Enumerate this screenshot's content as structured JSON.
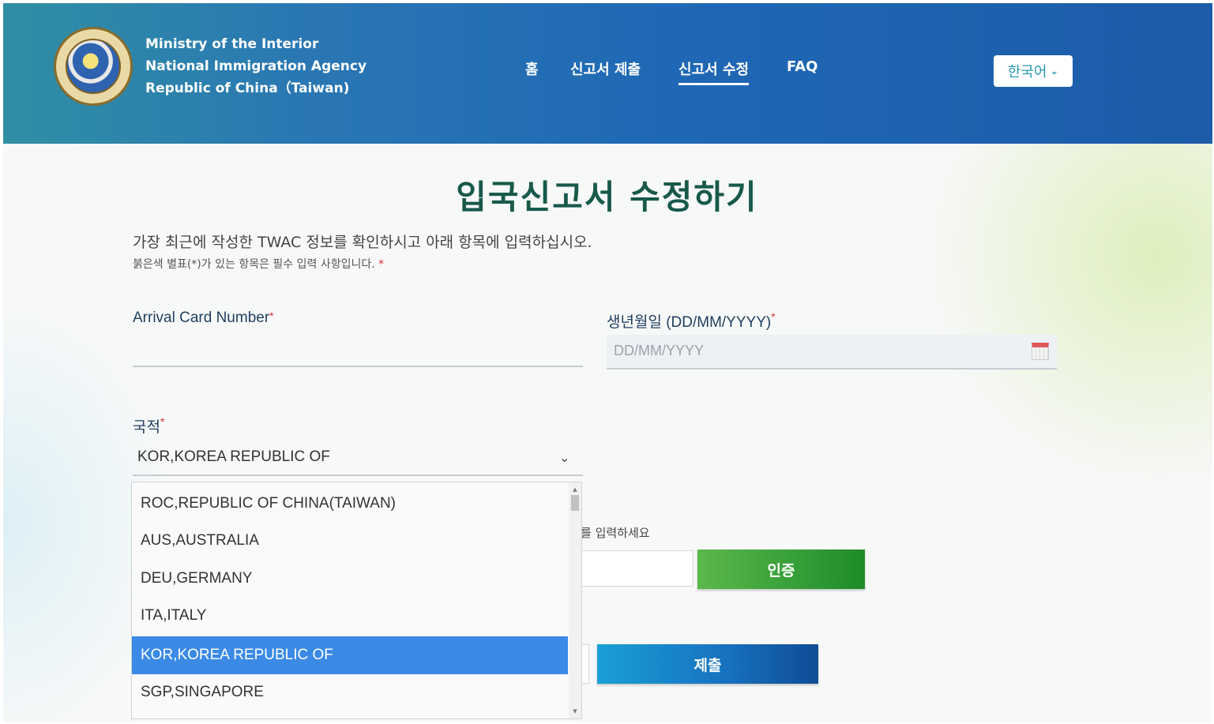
{
  "header": {
    "agency_lines": [
      "Ministry of the Interior",
      "National Immigration Agency",
      "Republic of China（Taiwan)"
    ],
    "nav": [
      {
        "label": "홈"
      },
      {
        "label": "신고서 제출"
      },
      {
        "label": "신고서 수정",
        "active": true
      },
      {
        "label": "FAQ"
      }
    ],
    "language": "한국어"
  },
  "page": {
    "title": "입국신고서 수정하기",
    "intro": "가장 최근에 작성한 TWAC 정보를 확인하시고 아래 항목에 입력하십시오.",
    "required_note": "붉은색 별표(*)가 있는 항목은 필수 입력 사항입니다.",
    "required_mark": "*"
  },
  "form": {
    "arrival_card_label": "Arrival Card Number",
    "arrival_card_value": "",
    "dob_label": "생년월일 (DD/MM/YYYY)",
    "dob_placeholder": "DD/MM/YYYY",
    "nationality_label": "국적",
    "nationality_value": "KOR,KOREA REPUBLIC OF",
    "code_hint_partial": "를 입력하세요",
    "verify_button": "인증",
    "submit_button": "제출"
  },
  "dropdown": {
    "options": [
      "ROC,REPUBLIC OF CHINA(TAIWAN)",
      "AUS,AUSTRALIA",
      "DEU,GERMANY",
      "ITA,ITALY",
      "KOR,KOREA REPUBLIC OF",
      "SGP,SINGAPORE"
    ],
    "selected_index": 4
  },
  "colors": {
    "header_blue": "#1c5ca9",
    "title_green": "#18594a",
    "verify_green": "#2f9a35",
    "submit_blue": "#1770bd",
    "selected_option": "#3a8ae6",
    "required_red": "#d6303a"
  },
  "icons": [
    "agency-seal-logo",
    "chevron-down-icon",
    "calendar-icon"
  ]
}
